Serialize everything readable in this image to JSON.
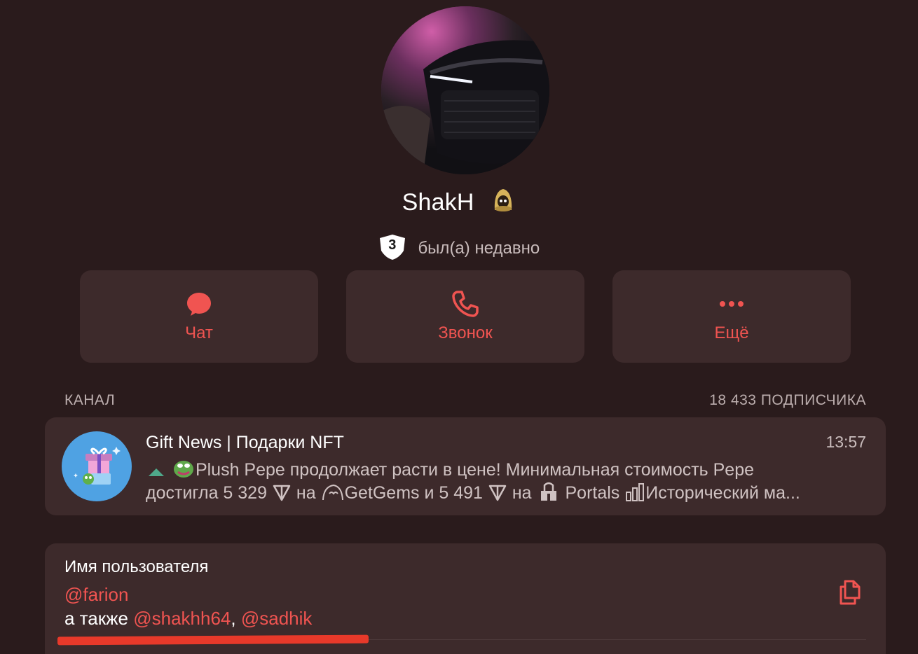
{
  "profile": {
    "name": "ShakH",
    "level": "3",
    "status": "был(а) недавно"
  },
  "actions": {
    "chat": "Чат",
    "call": "Звонок",
    "more": "Ещё"
  },
  "channel_section": {
    "label": "КАНАЛ",
    "subscribers": "18 433 ПОДПИСЧИКА"
  },
  "channel": {
    "title": "Gift News | Подарки NFT",
    "time": "13:57",
    "line1_text": "Plush Pepe продолжает расти в цене!  Минимальная стоимость Pepe",
    "line2_a": "достигла 5 329",
    "line2_b": "на",
    "line2_c": "GetGems и 5 491",
    "line2_d": "на",
    "line2_e": "Portals",
    "line2_f": "Исторический ма..."
  },
  "username_section": {
    "label": "Имя пользователя",
    "username": "@farion",
    "also_prefix": "а также",
    "also_user1": "@shakhh64",
    "separator": ",",
    "also_user2": "@sadhik"
  },
  "colors": {
    "background": "#2a1b1c",
    "card": "#3d2a2b",
    "accent": "#f05451",
    "annotation": "#e8392a"
  },
  "icons": [
    "chat-bubble-icon",
    "phone-icon",
    "more-dots-icon",
    "copy-icon",
    "ton-icon",
    "trend-up-icon",
    "chart-icon"
  ]
}
